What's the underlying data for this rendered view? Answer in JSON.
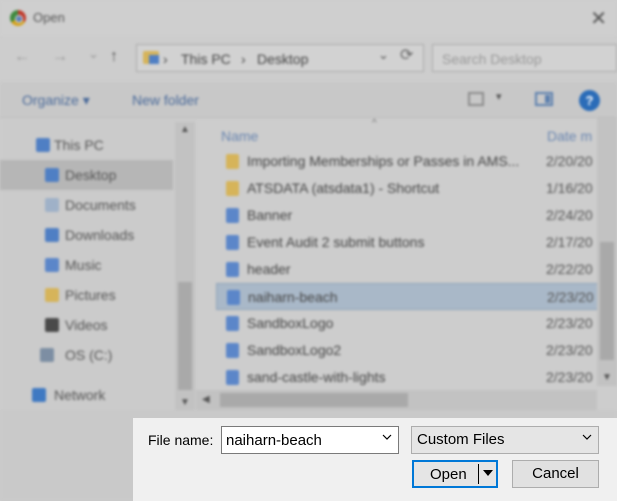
{
  "window": {
    "title": "Open",
    "close_glyph": "✕"
  },
  "nav_buttons": {
    "back": "←",
    "forward": "→",
    "recent": "⌄",
    "up": "↑"
  },
  "address": {
    "crumbs": [
      "This PC",
      "Desktop"
    ],
    "separator": "›",
    "chevron": "⌄",
    "refresh": "⟳"
  },
  "search": {
    "placeholder": "Search Desktop"
  },
  "toolbar": {
    "organize": "Organize ▾",
    "new_folder": "New folder",
    "view_drop": "▾",
    "help": "?"
  },
  "nav_pane": {
    "items": [
      {
        "label": "This PC",
        "icon": "computer-icon",
        "color": "#4f7fc4"
      },
      {
        "label": "Desktop",
        "icon": "desktop-folder-icon",
        "color": "#4f7fc4",
        "selected": true
      },
      {
        "label": "Documents",
        "icon": "documents-icon",
        "color": "#9fb1c8"
      },
      {
        "label": "Downloads",
        "icon": "downloads-icon",
        "color": "#4f7fc4"
      },
      {
        "label": "Music",
        "icon": "music-icon",
        "color": "#5b86c9"
      },
      {
        "label": "Pictures",
        "icon": "pictures-icon",
        "color": "#d6b45a"
      },
      {
        "label": "Videos",
        "icon": "videos-icon",
        "color": "#4a4a4a"
      },
      {
        "label": "OS (C:)",
        "icon": "drive-icon",
        "color": "#7d8ea3"
      },
      {
        "label": "Network",
        "icon": "network-icon",
        "color": "#3f79c2"
      }
    ]
  },
  "file_list": {
    "columns": {
      "name": "Name",
      "date": "Date m"
    },
    "rows": [
      {
        "name": "Importing Memberships or Passes in AMS...",
        "date": "2/20/20",
        "icon": "folder-icon",
        "color": "#d6b45a"
      },
      {
        "name": "ATSDATA (atsdata1) - Shortcut",
        "date": "1/16/20",
        "icon": "shortcut-icon",
        "color": "#d6b45a"
      },
      {
        "name": "Banner",
        "date": "2/24/20",
        "icon": "image-file-icon",
        "color": "#5b86c9"
      },
      {
        "name": "Event Audit 2 submit buttons",
        "date": "2/17/20",
        "icon": "image-file-icon",
        "color": "#5b86c9"
      },
      {
        "name": "header",
        "date": "2/22/20",
        "icon": "image-file-icon",
        "color": "#5b86c9"
      },
      {
        "name": "naiharn-beach",
        "date": "2/23/20",
        "icon": "image-file-icon",
        "color": "#5b86c9",
        "selected": true
      },
      {
        "name": "SandboxLogo",
        "date": "2/23/20",
        "icon": "image-file-icon",
        "color": "#5b86c9"
      },
      {
        "name": "SandboxLogo2",
        "date": "2/23/20",
        "icon": "image-file-icon",
        "color": "#5b86c9"
      },
      {
        "name": "sand-castle-with-lights",
        "date": "2/23/20",
        "icon": "image-file-icon",
        "color": "#5b86c9"
      }
    ]
  },
  "bottom": {
    "file_name_label": "File name:",
    "file_name_value": "naiharn-beach",
    "file_type": "Custom Files",
    "open_label": "Open",
    "cancel_label": "Cancel"
  },
  "colors": {
    "accent": "#0078d7",
    "selection": "#a9b8c8"
  }
}
